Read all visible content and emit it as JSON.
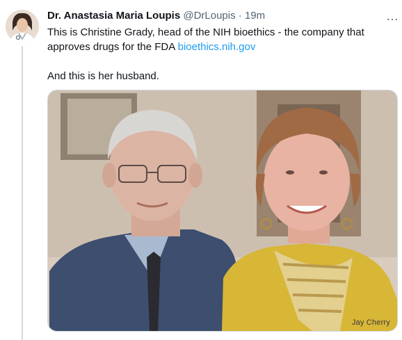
{
  "tweet": {
    "author_name": "Dr. Anastasia Maria Loupis",
    "author_handle": "@DrLoupis",
    "separator": "·",
    "timestamp": "19m",
    "more_icon": "…",
    "text_line1": "This is Christine Grady, head of the NIH bioethics - the company that approves drugs for the FDA ",
    "link": "bioethics.nih.gov",
    "text_line2": "And this is her husband.",
    "media": {
      "watermark": "Jay Cherry"
    }
  },
  "icons": {
    "more": "more-horizontal-icon",
    "avatar": "profile-avatar"
  },
  "colors": {
    "link": "#1d9bf0",
    "secondary_text": "#536471",
    "thread_line": "#cfd9de"
  }
}
